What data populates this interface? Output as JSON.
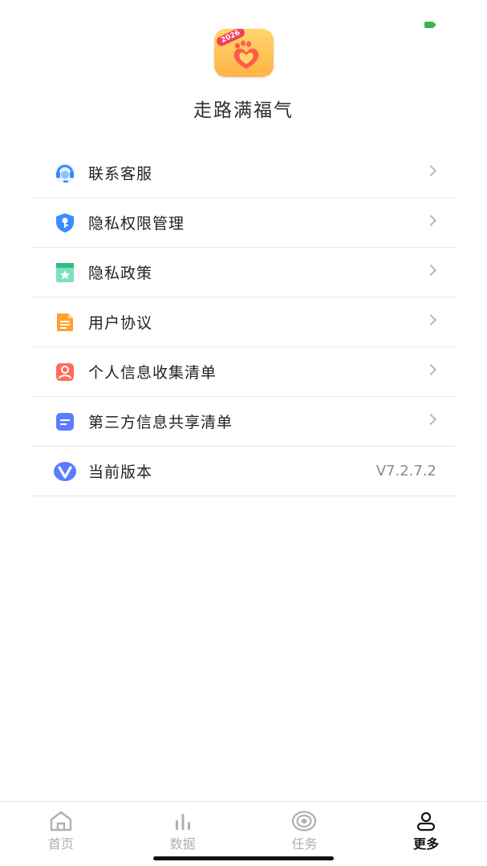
{
  "app": {
    "name": "走路满福气",
    "logo_badge": "2026"
  },
  "menu": {
    "items": [
      {
        "label": "联系客服",
        "icon": "customer-service-icon"
      },
      {
        "label": "隐私权限管理",
        "icon": "shield-key-icon"
      },
      {
        "label": "隐私政策",
        "icon": "bookmark-star-icon"
      },
      {
        "label": "用户协议",
        "icon": "document-icon"
      },
      {
        "label": "个人信息收集清单",
        "icon": "person-card-icon"
      },
      {
        "label": "第三方信息共享清单",
        "icon": "list-doc-icon"
      },
      {
        "label": "当前版本",
        "icon": "version-v-icon",
        "value": "V7.2.7.2"
      }
    ]
  },
  "tabbar": {
    "tabs": [
      {
        "label": "首页",
        "icon": "home-icon",
        "active": false
      },
      {
        "label": "数据",
        "icon": "bar-chart-icon",
        "active": false
      },
      {
        "label": "任务",
        "icon": "target-icon",
        "active": false
      },
      {
        "label": "更多",
        "icon": "user-icon",
        "active": true
      }
    ]
  },
  "colors": {
    "accent_orange": "#ffb347",
    "badge_red": "#f23e5b",
    "battery_green": "#3bb54a",
    "tab_inactive": "#b0b0b0",
    "tab_active": "#111111"
  }
}
